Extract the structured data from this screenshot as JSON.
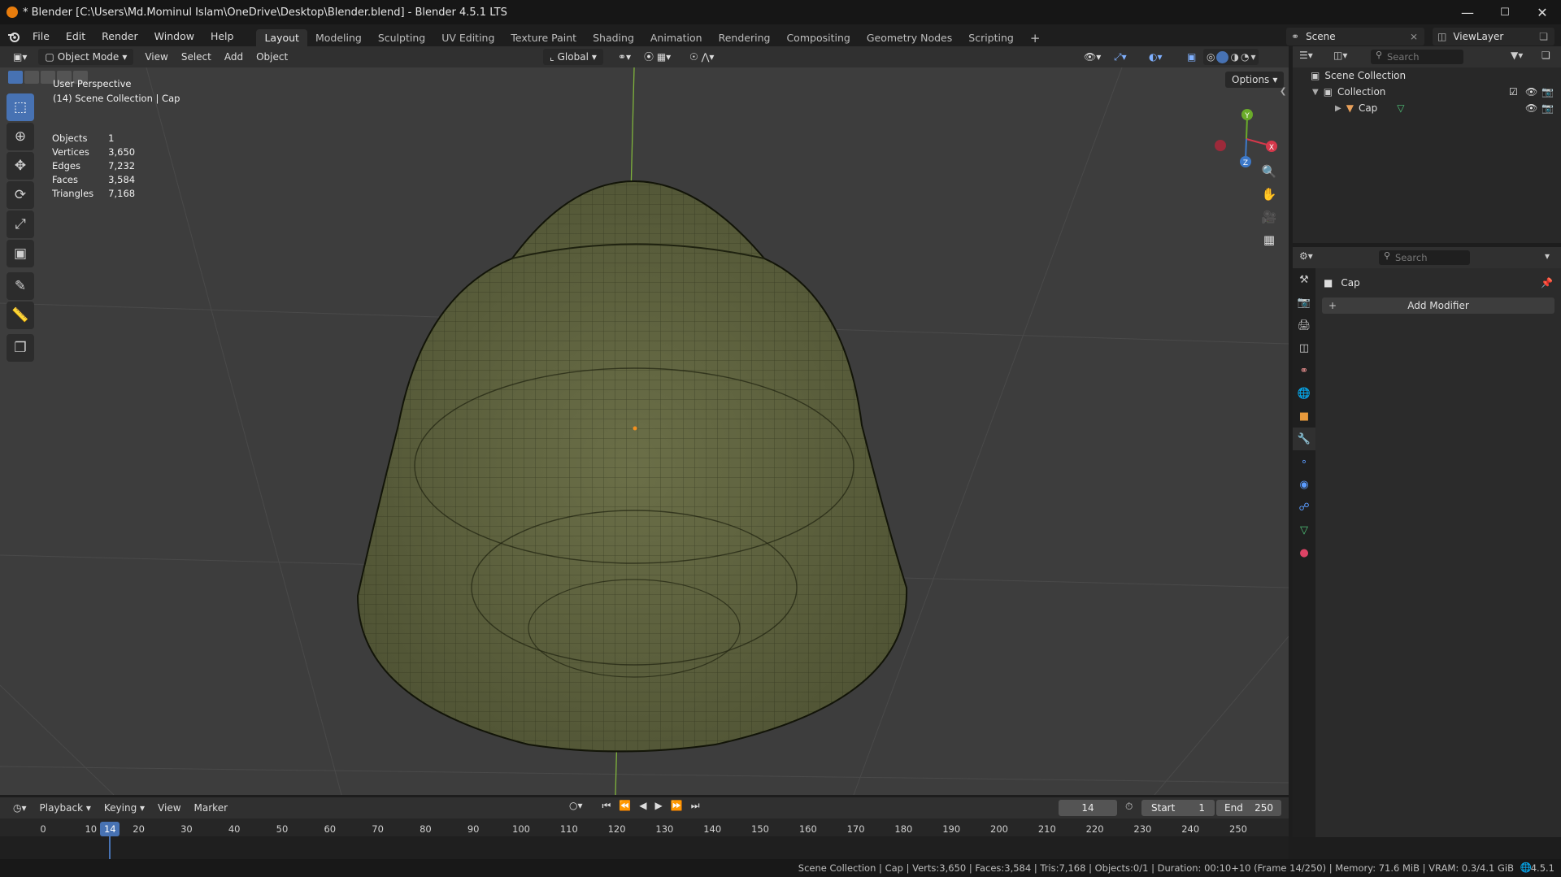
{
  "window": {
    "title": "* Blender [C:\\Users\\Md.Mominul Islam\\OneDrive\\Desktop\\Blender.blend] - Blender 4.5.1 LTS",
    "controls": [
      "—",
      "☐",
      "✕"
    ]
  },
  "menu": {
    "items": [
      "File",
      "Edit",
      "Render",
      "Window",
      "Help"
    ],
    "workspaces": [
      "Layout",
      "Modeling",
      "Sculpting",
      "UV Editing",
      "Texture Paint",
      "Shading",
      "Animation",
      "Rendering",
      "Compositing",
      "Geometry Nodes",
      "Scripting"
    ],
    "active_workspace": "Layout",
    "add_workspace": "+",
    "scene_label": "Scene",
    "view_layer_label": "ViewLayer"
  },
  "viewport_header": {
    "mode": "Object Mode",
    "menus": [
      "View",
      "Select",
      "Add",
      "Object"
    ],
    "orientation": "Global",
    "options_label": "Options"
  },
  "viewport": {
    "perspective": "User Perspective",
    "context": "(14) Scene Collection | Cap",
    "stats": [
      {
        "label": "Objects",
        "value": "1"
      },
      {
        "label": "Vertices",
        "value": "3,650"
      },
      {
        "label": "Edges",
        "value": "7,232"
      },
      {
        "label": "Faces",
        "value": "3,584"
      },
      {
        "label": "Triangles",
        "value": "7,168"
      }
    ],
    "gizmo": {
      "x": "X",
      "y": "Y",
      "z": "Z"
    },
    "mesh_color": "#5b5e3c",
    "background_color": "#3d3d3d"
  },
  "outliner": {
    "search_placeholder": "Search",
    "rows": [
      {
        "label": "Scene Collection"
      },
      {
        "label": "Collection"
      },
      {
        "label": "Cap"
      }
    ]
  },
  "properties": {
    "search_placeholder": "Search",
    "object_name": "Cap",
    "add_modifier_label": "Add Modifier"
  },
  "timeline": {
    "menus": [
      "Playback",
      "Keying",
      "View",
      "Marker"
    ],
    "current_frame": "14",
    "start_label": "Start",
    "start_value": "1",
    "end_label": "End",
    "end_value": "250",
    "ticks": [
      "0",
      "10",
      "20",
      "30",
      "40",
      "50",
      "60",
      "70",
      "80",
      "90",
      "100",
      "110",
      "120",
      "130",
      "140",
      "150",
      "160",
      "170",
      "180",
      "190",
      "200",
      "210",
      "220",
      "230",
      "240",
      "250"
    ],
    "playhead_label": "14"
  },
  "statusbar": {
    "text": "Scene Collection | Cap | Verts:3,650 | Faces:3,584 | Tris:7,168 | Objects:0/1 | Duration: 00:10+10 (Frame 14/250) | Memory: 71.6 MiB | VRAM: 0.3/4.1 GiB",
    "version": "4.5.1"
  },
  "colors": {
    "accent": "#4772b3",
    "blender_orange": "#e87d0d",
    "active_frame": "#4772b3"
  }
}
